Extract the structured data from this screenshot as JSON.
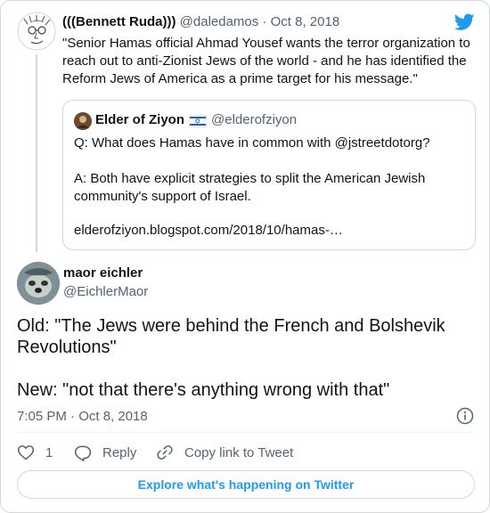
{
  "parent_tweet": {
    "author_name": "(((Bennett Ruda)))",
    "author_handle": "@daledamos",
    "separator": "·",
    "date": "Oct 8, 2018",
    "text": "\"Senior Hamas official Ahmad Yousef wants the terror organization to reach out to anti-Zionist Jews of the world - and he has identified the Reform Jews of America as a prime target for his message.\""
  },
  "quoted_tweet": {
    "author_name": "Elder of Ziyon",
    "flag": "israel-flag-icon",
    "author_handle": "@elderofziyon",
    "lines": [
      "Q: What does Hamas have in common with @jstreetdotorg?",
      "A: Both have explicit strategies to split the American Jewish",
      "community's support of Israel.",
      "elderofziyon.blogspot.com/2018/10/hamas-…"
    ]
  },
  "main_tweet": {
    "author_name": "maor eichler",
    "author_handle": "@EichlerMaor",
    "lines": [
      "Old: \"The Jews were behind the French and Bolshevik",
      "Revolutions\"",
      "New: \"not that there's anything wrong with that\""
    ],
    "timestamp": "7:05 PM · Oct 8, 2018"
  },
  "actions": {
    "like_count": "1",
    "reply_label": "Reply",
    "copy_link_label": "Copy link to Tweet"
  },
  "explore_label": "Explore what's happening on Twitter",
  "colors": {
    "twitter_blue": "#1d9bf0",
    "muted_text": "#536471",
    "border": "#cfd9de"
  }
}
